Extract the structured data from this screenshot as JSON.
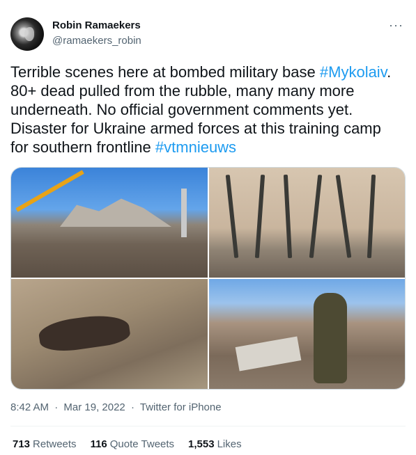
{
  "author": {
    "name": "Robin Ramaekers",
    "handle": "@ramaekers_robin"
  },
  "menu": {
    "more_label": "···"
  },
  "tweet": {
    "segments": [
      {
        "text": "Terrible scenes here at bombed military base ",
        "tag": false
      },
      {
        "text": "#Mykolaiv",
        "tag": true
      },
      {
        "text": ". 80+ dead pulled from the rubble, many many more underneath. No official government comments yet. Disaster for Ukraine armed forces at this training camp for southern frontline ",
        "tag": false
      },
      {
        "text": "#vtmnieuws",
        "tag": true
      }
    ]
  },
  "meta": {
    "time": "8:42 AM",
    "dot1": "·",
    "date": "Mar 19, 2022",
    "dot2": "·",
    "source": "Twitter for iPhone"
  },
  "stats": {
    "retweets_count": "713",
    "retweets_label": "Retweets",
    "quotes_count": "116",
    "quotes_label": "Quote Tweets",
    "likes_count": "1,553",
    "likes_label": "Likes"
  }
}
